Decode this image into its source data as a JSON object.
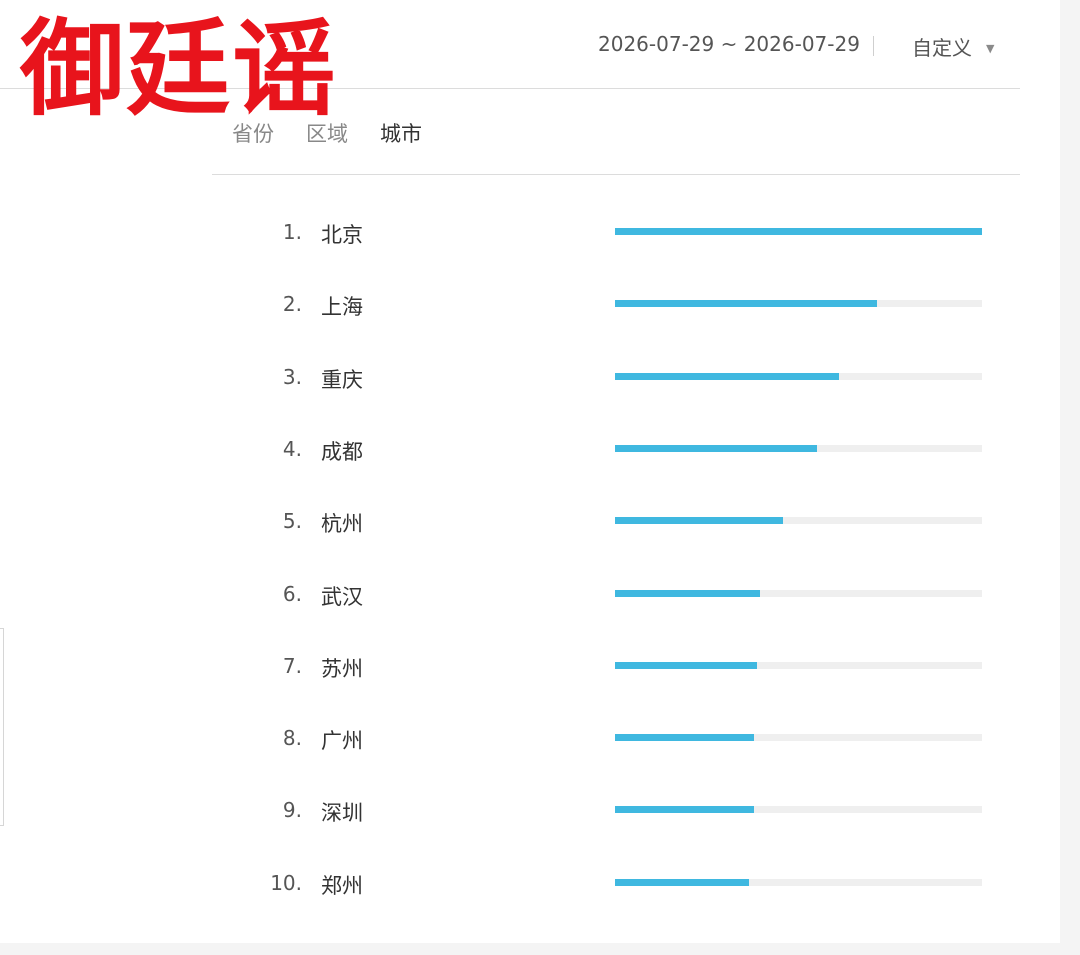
{
  "watermark": "御廷谣",
  "header": {
    "date_range": "2026-07-29 ~ 2026-07-29",
    "custom_label": "自定义"
  },
  "tabs": [
    {
      "label": "省份",
      "active": false
    },
    {
      "label": "区域",
      "active": false
    },
    {
      "label": "城市",
      "active": true
    }
  ],
  "colors": {
    "bar_fill": "#3fb8e0",
    "bar_track": "#efefef",
    "watermark": "#e8141c"
  },
  "ranking": [
    {
      "rank": "1.",
      "city": "北京",
      "fraction": 1.0
    },
    {
      "rank": "2.",
      "city": "上海",
      "fraction": 0.713
    },
    {
      "rank": "3.",
      "city": "重庆",
      "fraction": 0.61
    },
    {
      "rank": "4.",
      "city": "成都",
      "fraction": 0.55
    },
    {
      "rank": "5.",
      "city": "杭州",
      "fraction": 0.458
    },
    {
      "rank": "6.",
      "city": "武汉",
      "fraction": 0.395
    },
    {
      "rank": "7.",
      "city": "苏州",
      "fraction": 0.387
    },
    {
      "rank": "8.",
      "city": "广州",
      "fraction": 0.38
    },
    {
      "rank": "9.",
      "city": "深圳",
      "fraction": 0.378
    },
    {
      "rank": "10.",
      "city": "郑州",
      "fraction": 0.366
    }
  ]
}
